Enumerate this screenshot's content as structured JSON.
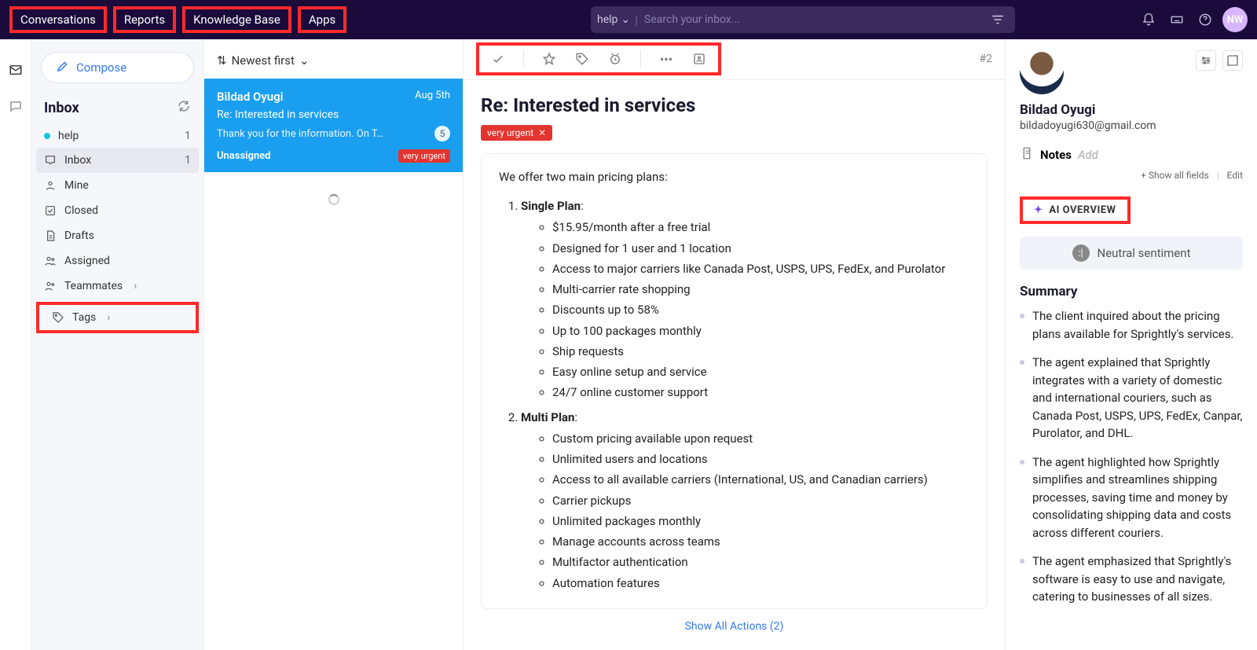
{
  "nav": {
    "items": [
      "Conversations",
      "Reports",
      "Knowledge Base",
      "Apps"
    ]
  },
  "search": {
    "scope": "help",
    "placeholder": "Search your inbox..."
  },
  "profile": {
    "initials": "NW"
  },
  "sidebar": {
    "compose": "Compose",
    "inbox_label": "Inbox",
    "mailbox": "help",
    "mailbox_count": "1",
    "folders": [
      {
        "label": "Inbox",
        "count": "1",
        "icon": "inbox"
      },
      {
        "label": "Mine",
        "icon": "person"
      },
      {
        "label": "Closed",
        "icon": "check-box"
      },
      {
        "label": "Drafts",
        "icon": "doc"
      },
      {
        "label": "Assigned",
        "icon": "people"
      },
      {
        "label": "Teammates",
        "icon": "people",
        "chevron": true
      }
    ],
    "tags_label": "Tags"
  },
  "convlist": {
    "sort": "Newest first",
    "item": {
      "name": "Bildad Oyugi",
      "date": "Aug 5th",
      "subject": "Re: Interested in services",
      "preview": "Thank you for the information.  On T…",
      "count": "5",
      "status": "Unassigned",
      "tag": "very urgent"
    }
  },
  "reader": {
    "ticket_num": "#2",
    "title": "Re: Interested in services",
    "tag": "very urgent",
    "intro": "We offer two main pricing plans:",
    "plan1_title": "Single Plan",
    "plan1": [
      "$15.95/month after a free trial",
      "Designed for 1 user and 1 location",
      "Access to major carriers like Canada Post, USPS, UPS, FedEx, and Purolator",
      "Multi-carrier rate shopping",
      "Discounts up to 58%",
      "Up to 100 packages monthly",
      "Ship requests",
      "Easy online setup and service",
      "24/7 online customer support"
    ],
    "plan2_title": "Multi Plan",
    "plan2": [
      "Custom pricing available upon request",
      "Unlimited users and locations",
      "Access to all available carriers (International, US, and Canadian carriers)",
      "Carrier pickups",
      "Unlimited packages monthly",
      "Manage accounts across teams",
      "Multifactor authentication",
      "Automation features"
    ],
    "show_all": "Show All Actions (2)"
  },
  "details": {
    "name": "Bildad Oyugi",
    "email": "bildadoyugi630@gmail.com",
    "notes_label": "Notes",
    "notes_add": "Add",
    "show_fields": "+ Show all fields",
    "edit": "Edit",
    "ai_overview": "AI OVERVIEW",
    "sentiment": "Neutral sentiment",
    "summary_label": "Summary",
    "summary": [
      "The client inquired about the pricing plans available for Sprightly's services.",
      "The agent explained that Sprightly integrates with a variety of domestic and international couriers, such as Canada Post, USPS, UPS, FedEx, Canpar, Purolator, and DHL.",
      "The agent highlighted how Sprightly simplifies and streamlines shipping processes, saving time and money by consolidating shipping data and costs across different couriers.",
      "The agent emphasized that Sprightly's software is easy to use and navigate, catering to businesses of all sizes."
    ]
  }
}
